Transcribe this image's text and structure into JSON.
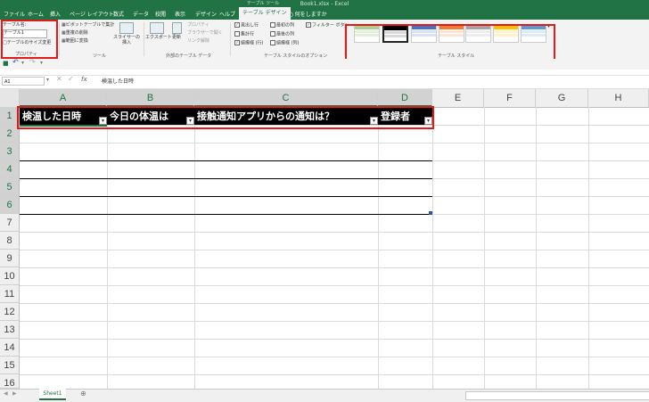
{
  "window": {
    "title": "Book1.xlsx - Excel",
    "context_label": "テーブル ツール"
  },
  "tabs": [
    {
      "label": "ファイル"
    },
    {
      "label": "ホーム"
    },
    {
      "label": "挿入"
    },
    {
      "label": "ページ レイアウト"
    },
    {
      "label": "数式"
    },
    {
      "label": "データ"
    },
    {
      "label": "校閲"
    },
    {
      "label": "表示"
    },
    {
      "label": "デザイン"
    },
    {
      "label": "ヘルプ"
    },
    {
      "label": "テーブル デザイン",
      "active": true
    }
  ],
  "tell_me": "何をしますか",
  "ribbon": {
    "properties": {
      "name_label": "テーブル名:",
      "name_value": "テーブル1",
      "resize": "テーブルのサイズ変更",
      "group": "プロパティ"
    },
    "tools": {
      "pivot": "ピボットテーブルで集計",
      "remove_dup": "重複の削除",
      "convert": "範囲に変換",
      "slicer": "スライサーの挿入",
      "group": "ツール"
    },
    "external": {
      "export": "エクスポート",
      "refresh": "更新",
      "props": "プロパティ",
      "open_browser": "ブラウザーで開く",
      "unlink": "リンク解除",
      "group": "外部のテーブル データ"
    },
    "style_options": {
      "header_row": "見出し行",
      "total_row": "集計行",
      "banded_rows": "縞模様 (行)",
      "first_col": "最初の列",
      "last_col": "最後の列",
      "banded_cols": "縞模様 (列)",
      "filter_button": "フィルター ボタン",
      "group": "テーブル スタイルのオプション"
    },
    "styles": {
      "group": "テーブル スタイル"
    }
  },
  "formula_bar": {
    "name_box": "A1",
    "content": "検温した日時",
    "fx": "fx"
  },
  "columns": [
    "A",
    "B",
    "C",
    "D",
    "E",
    "F",
    "G",
    "H"
  ],
  "rows": [
    "1",
    "2",
    "3",
    "4",
    "5",
    "6",
    "7",
    "8",
    "9",
    "10",
    "11",
    "12",
    "13",
    "14",
    "15",
    "16"
  ],
  "table_headers": [
    "検温した日時",
    "今日の体温は",
    "接触通知アプリからの通知は？",
    "登録者"
  ],
  "sheet": {
    "tab": "Sheet1"
  },
  "colors": {
    "excel_green": "#217346",
    "highlight": "#e21a1a",
    "header_fill": "#000000"
  }
}
